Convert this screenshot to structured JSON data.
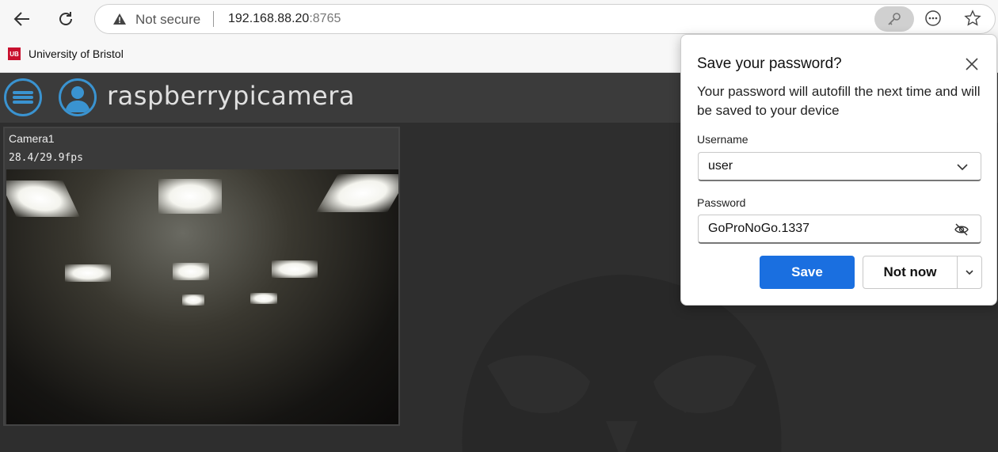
{
  "browser": {
    "security_label": "Not secure",
    "host": "192.168.88.20",
    "port": ":8765"
  },
  "bookmarks": [
    {
      "label": "University of Bristol"
    }
  ],
  "app": {
    "title": "raspberrypicamera",
    "accent_color": "#3a93d0",
    "camera": {
      "name": "Camera1",
      "fps": "28.4/29.9fps"
    }
  },
  "password_popup": {
    "title": "Save your password?",
    "description": "Your password will autofill the next time and will be saved to your device",
    "username_label": "Username",
    "username_value": "user",
    "password_label": "Password",
    "password_value": "GoProNoGo.1337",
    "save_label": "Save",
    "not_now_label": "Not now",
    "save_color": "#1a6fe0"
  }
}
